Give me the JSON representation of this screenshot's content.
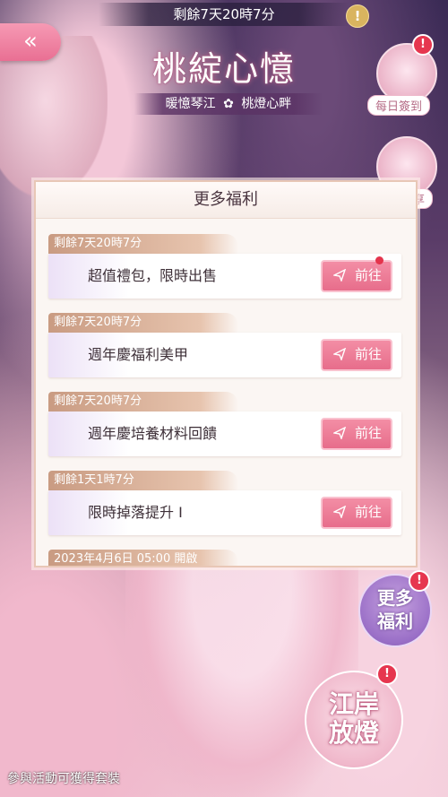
{
  "countdown": "剩餘7天20時7分",
  "info_icon": "!",
  "back_icon": "«",
  "event": {
    "title": "桃綻心憶",
    "subtitle_left": "暖憶琴江",
    "subtitle_star": "✿",
    "subtitle_right": "桃燈心畔"
  },
  "side_menu": {
    "daily_signin_label": "每日簽到",
    "second_label_partial": "享",
    "badge": "!"
  },
  "panel": {
    "title": "更多福利",
    "items": [
      {
        "tag": "剩餘7天20時7分",
        "label": "超值禮包，限時出售",
        "button": "前往",
        "has_dot": true
      },
      {
        "tag": "剩餘7天20時7分",
        "label": "週年慶福利美甲",
        "button": "前往",
        "has_dot": false
      },
      {
        "tag": "剩餘7天20時7分",
        "label": "週年慶培養材料回饋",
        "button": "前往",
        "has_dot": false
      },
      {
        "tag": "剩餘1天1時7分",
        "label": "限時掉落提升 I",
        "button": "前往",
        "has_dot": false
      },
      {
        "tag": "2023年4月6日 05:00 開啟",
        "label": "",
        "button": "",
        "has_dot": false
      }
    ]
  },
  "more_benefits_button": {
    "line1": "更多",
    "line2": "福利",
    "badge": "!"
  },
  "lantern_button": {
    "line1": "江岸",
    "line2": "放燈",
    "badge": "!"
  },
  "footer": "參與活動可獲得套裝",
  "colors": {
    "accent_pink": "#e76d8b",
    "badge_red": "#e6364f",
    "tag_tan": "#c99b82"
  }
}
